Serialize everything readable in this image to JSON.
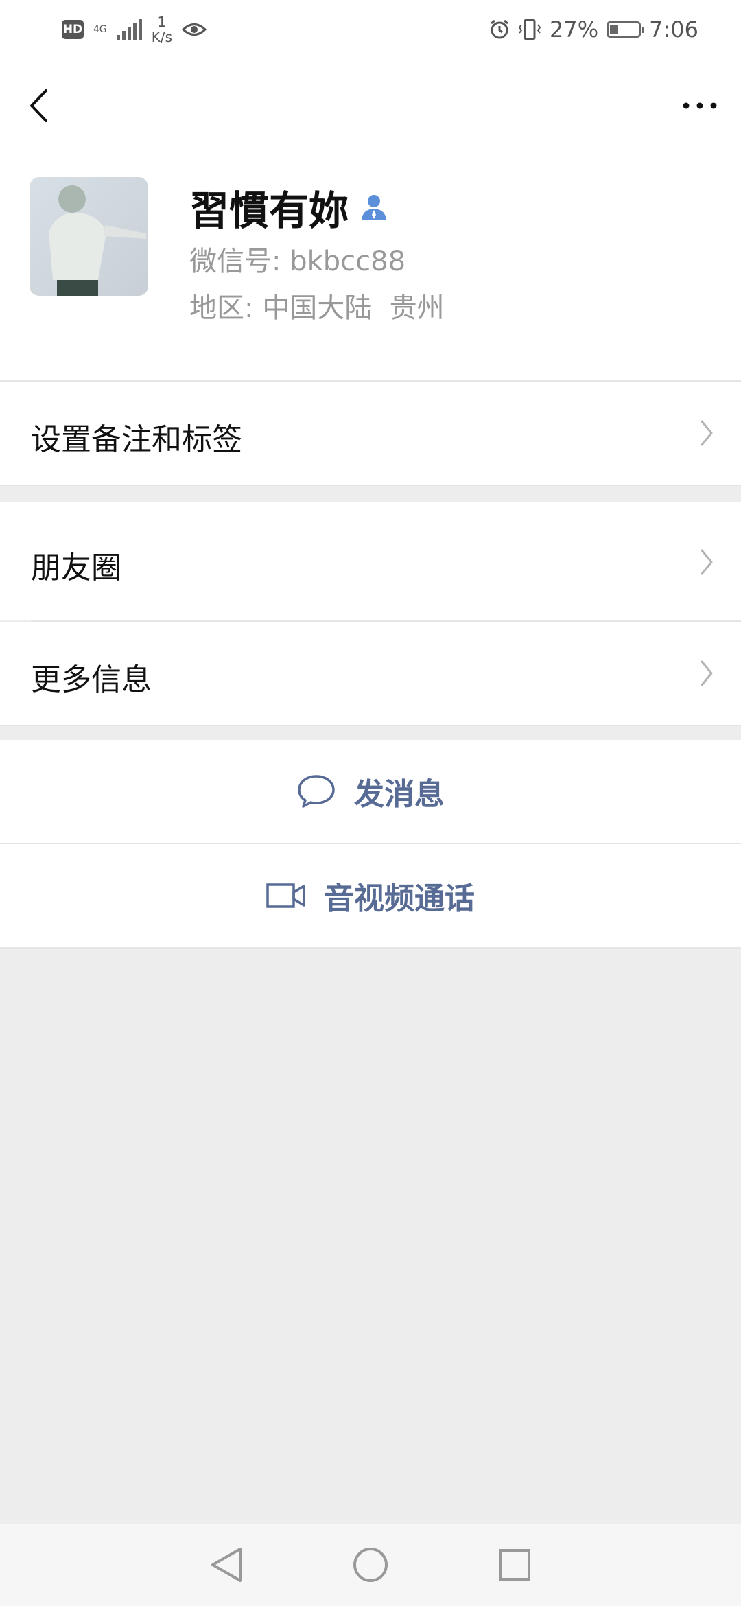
{
  "status_bar": {
    "hd": "HD",
    "network": "4G",
    "speed_value": "1",
    "speed_unit": "K/s",
    "battery_percent": "27%",
    "battery_level": 0.27,
    "time": "7:06"
  },
  "navbar": {
    "back_icon": "chevron-left-icon",
    "more_icon": "more-dots-icon"
  },
  "profile": {
    "name": "習慣有妳",
    "wechat_id": "微信号: bkbcc88",
    "region": "地区: 中国大陆  贵州",
    "contact_icon": "person-icon"
  },
  "rows": {
    "remark_label": "设置备注和标签",
    "moments_label": "朋友圈",
    "more_info_label": "更多信息"
  },
  "actions": {
    "message_label": "发消息",
    "video_call_label": "音视频通话"
  },
  "colors": {
    "link_blue": "#576b95",
    "background": "#ededed",
    "icon_blue": "#5b8fd9"
  }
}
